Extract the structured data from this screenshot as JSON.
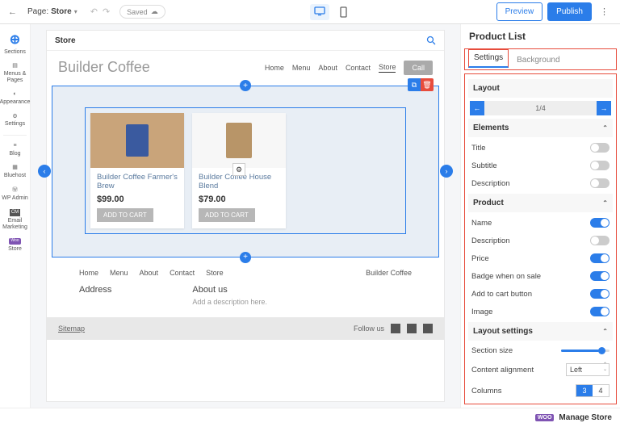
{
  "topbar": {
    "page_prefix": "Page:",
    "page_name": "Store",
    "saved": "Saved",
    "preview": "Preview",
    "publish": "Publish"
  },
  "leftnav": {
    "sections": "Sections",
    "menus": "Menus &\nPages",
    "appearance": "Appearance",
    "settings": "Settings",
    "blog": "Blog",
    "bluehost": "Bluehost",
    "wpadmin": "WP Admin",
    "email": "Email\nMarketing",
    "store": "Store"
  },
  "canvas": {
    "crumb": "Store",
    "brand": "Builder Coffee",
    "nav": [
      "Home",
      "Menu",
      "About",
      "Contact",
      "Store"
    ],
    "call": "Call",
    "products": [
      {
        "name": "Builder Coffee Farmer's Brew",
        "price": "$99.00",
        "atc": "ADD TO CART"
      },
      {
        "name": "Builder Coffee House Blend",
        "price": "$79.00",
        "atc": "ADD TO CART"
      }
    ],
    "footer_nav": [
      "Home",
      "Menu",
      "About",
      "Contact",
      "Store"
    ],
    "footer_brand": "Builder Coffee",
    "address": "Address",
    "about": "About us",
    "about_sub": "Add a description here.",
    "sitemap": "Sitemap",
    "follow": "Follow us"
  },
  "panel": {
    "title": "Product List",
    "tabs": {
      "settings": "Settings",
      "background": "Background"
    },
    "layout": {
      "h": "Layout",
      "pos": "1/4"
    },
    "elements": {
      "h": "Elements",
      "title": "Title",
      "subtitle": "Subtitle",
      "desc": "Description"
    },
    "product": {
      "h": "Product",
      "name": "Name",
      "desc": "Description",
      "price": "Price",
      "badge": "Badge when on sale",
      "atc": "Add to cart button",
      "image": "Image"
    },
    "layoutset": {
      "h": "Layout settings",
      "size": "Section size",
      "align": "Content alignment",
      "align_v": "Left",
      "cols": "Columns",
      "col3": "3",
      "col4": "4"
    }
  },
  "botbar": {
    "manage": "Manage Store",
    "woo": "WOO"
  }
}
